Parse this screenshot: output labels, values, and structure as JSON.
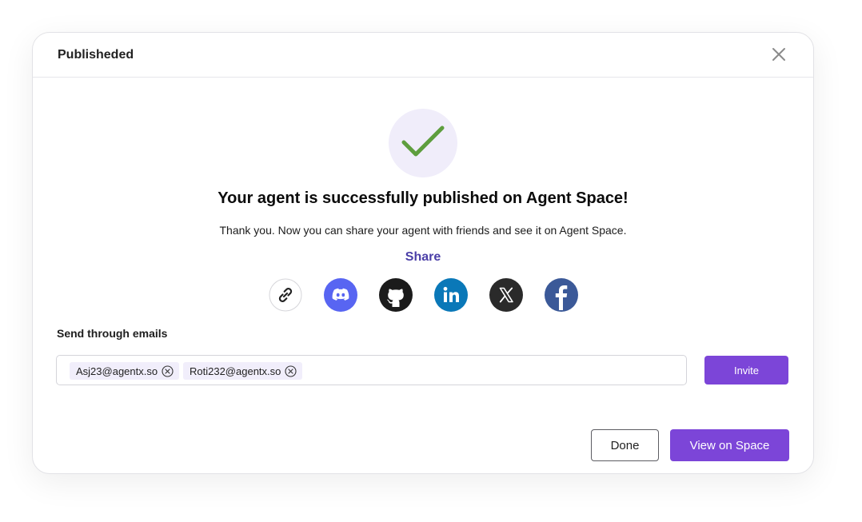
{
  "modal": {
    "title": "Publisheded",
    "headline": "Your agent is successfully published on Agent Space!",
    "subtext": "Thank you. Now you can share your agent with friends and see it on Agent Space.",
    "share_label": "Share",
    "share_icons": [
      {
        "name": "link-icon",
        "color": "#ffffff"
      },
      {
        "name": "discord-icon",
        "color": "#5865F2"
      },
      {
        "name": "github-icon",
        "color": "#1b1b1b"
      },
      {
        "name": "linkedin-icon",
        "color": "#0A78B8"
      },
      {
        "name": "x-icon",
        "color": "#2a2a2a"
      },
      {
        "name": "facebook-icon",
        "color": "#3B5998"
      }
    ],
    "emails_label": "Send through emails",
    "emails": [
      "Asj23@agentx.so",
      "Roti232@agentx.so"
    ],
    "invite_label": "Invite",
    "done_label": "Done",
    "view_label": "View on Space"
  },
  "colors": {
    "accent": "#7c45d8",
    "share_text": "#4b3fa8",
    "check": "#5e9e3e",
    "success_bg": "#f0edfa"
  }
}
